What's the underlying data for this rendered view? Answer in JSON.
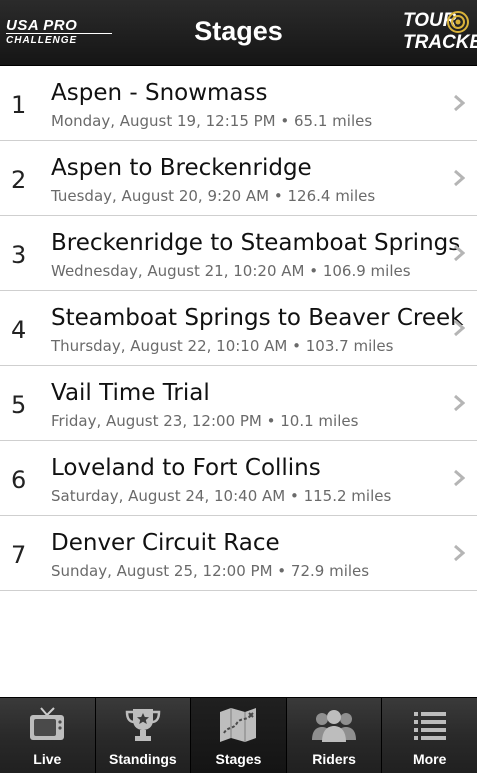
{
  "header": {
    "logo_left_line1": "USA PRO",
    "logo_left_line2": "CHALLENGE",
    "title": "Stages",
    "logo_right_line1": "TOUR",
    "logo_right_line2": "TRACKER"
  },
  "stages": [
    {
      "number": "1",
      "name": "Aspen - Snowmass",
      "details": "Monday, August 19, 12:15 PM • 65.1 miles"
    },
    {
      "number": "2",
      "name": "Aspen to Breckenridge",
      "details": "Tuesday, August 20, 9:20 AM • 126.4 miles"
    },
    {
      "number": "3",
      "name": "Breckenridge to Steamboat Springs",
      "details": "Wednesday, August 21, 10:20 AM • 106.9 miles"
    },
    {
      "number": "4",
      "name": "Steamboat Springs to Beaver Creek",
      "details": "Thursday, August 22, 10:10 AM • 103.7 miles"
    },
    {
      "number": "5",
      "name": "Vail Time Trial",
      "details": "Friday, August 23, 12:00 PM • 10.1 miles"
    },
    {
      "number": "6",
      "name": "Loveland to Fort Collins",
      "details": "Saturday, August 24, 10:40 AM • 115.2 miles"
    },
    {
      "number": "7",
      "name": "Denver Circuit Race",
      "details": "Sunday, August 25, 12:00 PM • 72.9 miles"
    }
  ],
  "tabs": [
    {
      "label": "Live",
      "icon": "tv-icon"
    },
    {
      "label": "Standings",
      "icon": "trophy-icon"
    },
    {
      "label": "Stages",
      "icon": "map-icon",
      "selected": true
    },
    {
      "label": "Riders",
      "icon": "people-icon"
    },
    {
      "label": "More",
      "icon": "list-icon"
    }
  ],
  "colors": {
    "header_bg": "#1e1e1e",
    "tabbar_bg": "#2a2a2a",
    "detail_text": "#6a6a6a",
    "divider": "#cfcfcf"
  }
}
